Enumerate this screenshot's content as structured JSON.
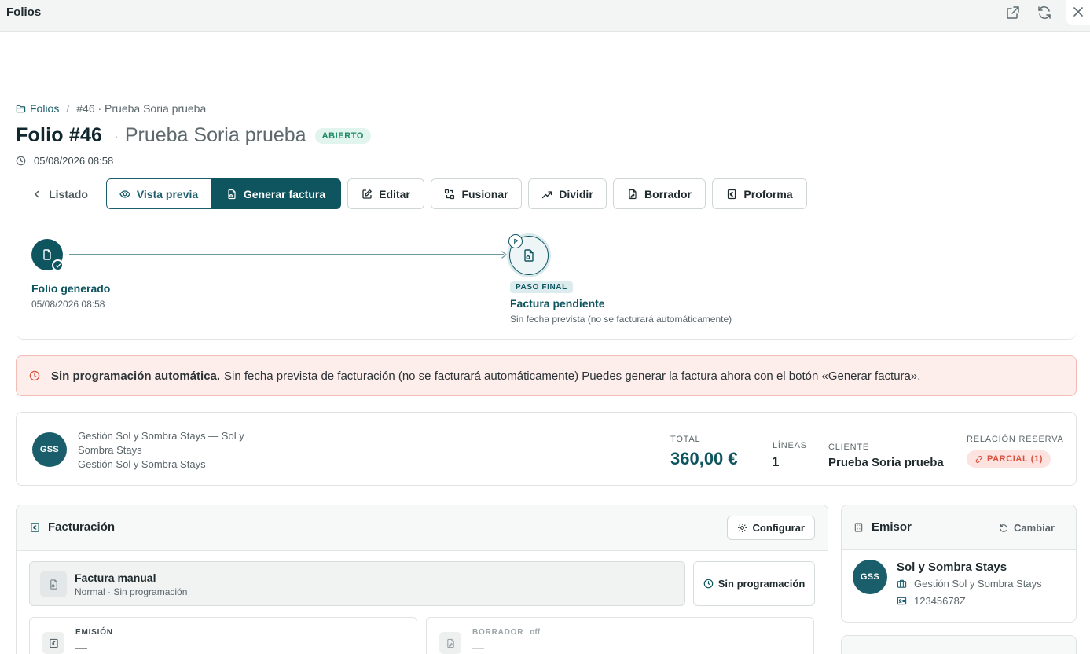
{
  "window": {
    "title": "Folios"
  },
  "breadcrumb": {
    "root": "Folios",
    "current": "#46 · Prueba Soria prueba"
  },
  "header": {
    "folio": "Folio #46",
    "dot": "·",
    "name": "Prueba Soria prueba",
    "status": "ABIERTO",
    "datetime": "05/08/2026 08:58"
  },
  "toolbar": {
    "back": "Listado",
    "preview": "Vista previa",
    "generate": "Generar factura",
    "edit": "Editar",
    "merge": "Fusionar",
    "split": "Dividir",
    "draft": "Borrador",
    "proforma": "Proforma"
  },
  "timeline": {
    "step1_title": "Folio generado",
    "step1_date": "05/08/2026 08:58",
    "step2_badge": "PASO FINAL",
    "step2_title": "Factura pendiente",
    "step2_desc": "Sin fecha prevista (no se facturará automáticamente)"
  },
  "alert": {
    "title": "Sin programación automática.",
    "text": "Sin fecha prevista de facturación (no se facturará automáticamente) Puedes generar la factura ahora con el botón «Generar factura»."
  },
  "summary": {
    "avatar": "GSS",
    "name": "Gestión Sol y Sombra Stays — Sol y Sombra Stays",
    "sub": "Gestión Sol y Sombra Stays",
    "total_label": "TOTAL",
    "total_value": "360,00 €",
    "lines_label": "LÍNEAS",
    "lines_value": "1",
    "client_label": "CLIENTE",
    "client_value": "Prueba Soria prueba",
    "relation_label": "RELACIÓN RESERVA",
    "relation_value": "PARCIAL (1)"
  },
  "billing": {
    "title": "Facturación",
    "configure": "Configurar",
    "manual_title": "Factura manual",
    "manual_sub": "Normal · Sin programación",
    "schedule": "Sin programación",
    "emission_label": "EMISIÓN",
    "emission_value": "—",
    "draft_label": "BORRADOR",
    "draft_state": "off",
    "draft_value": "—"
  },
  "issuer": {
    "title": "Emisor",
    "change": "Cambiar",
    "avatar": "GSS",
    "name": "Sol y Sombra Stays",
    "company": "Gestión Sol y Sombra Stays",
    "tax_id": "12345678Z"
  },
  "colors": {
    "primary": "#0f5560",
    "alert_bg": "#fdeeec",
    "alert_icon": "#d9503c",
    "open_badge": "#1d8a66"
  }
}
